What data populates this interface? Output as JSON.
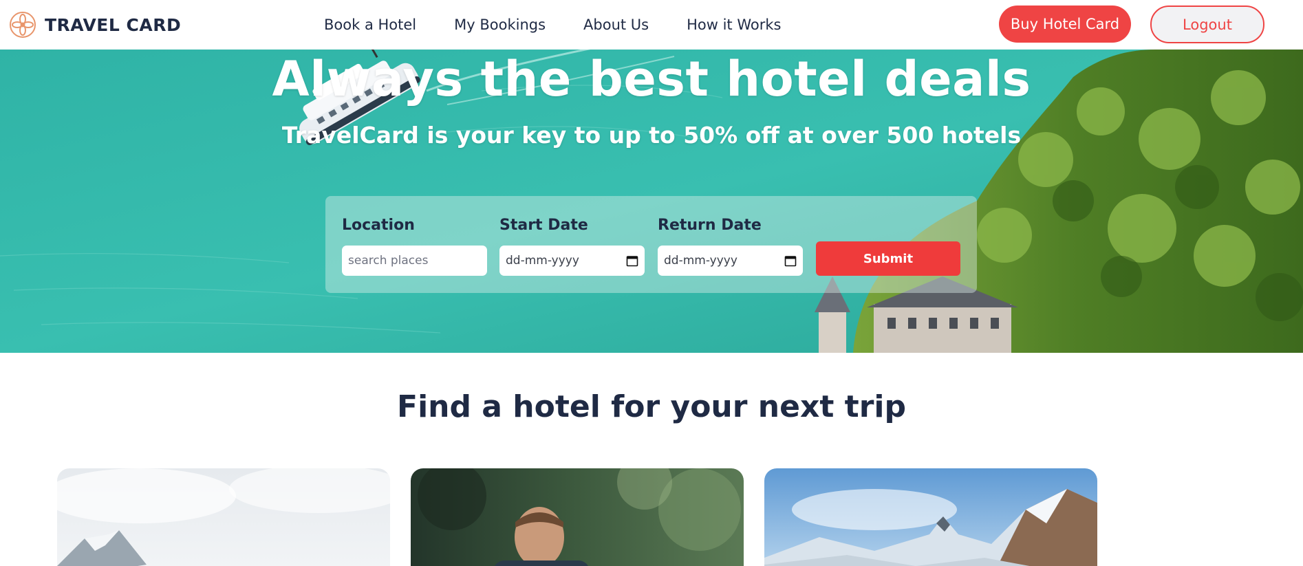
{
  "brand": {
    "name": "TRAVEL CARD",
    "logo_icon": "flower-logo-icon",
    "accent": "#ef4444",
    "logo_color": "#e8956b"
  },
  "nav": {
    "links": [
      "Book a Hotel",
      "My Bookings",
      "About Us",
      "How it Works"
    ],
    "buy_label": "Buy Hotel Card",
    "logout_label": "Logout"
  },
  "hero": {
    "title": "Always the best hotel deals",
    "subtitle": "TravelCard is your key to up to 50% off at over 500 hotels",
    "background": "lake-with-ferry-and-forest-photo"
  },
  "search": {
    "location_label": "Location",
    "location_placeholder": "search places",
    "start_label": "Start Date",
    "start_value": "dd-mm-yyyy",
    "return_label": "Return Date",
    "return_value": "dd-mm-yyyy",
    "submit_label": "Submit",
    "calendar_icon": "calendar-icon"
  },
  "section": {
    "title": "Find a hotel for your next trip"
  },
  "cards": [
    {
      "image": "snowy-mountain-photo"
    },
    {
      "image": "hiker-in-forest-photo"
    },
    {
      "image": "matterhorn-village-photo"
    }
  ]
}
